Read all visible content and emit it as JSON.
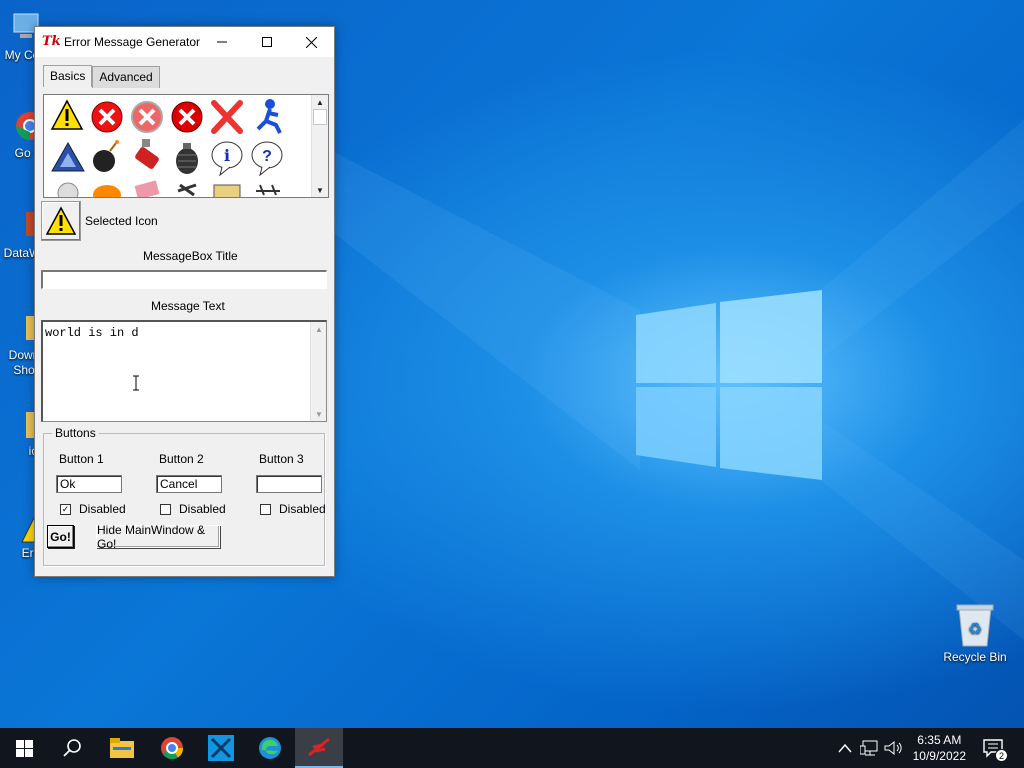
{
  "desktop": {
    "icons_left": [
      {
        "label": "My Co"
      },
      {
        "label": "Go Ch"
      },
      {
        "label": "DataW"
      },
      {
        "label": "Down Sho"
      },
      {
        "label": "ic"
      },
      {
        "label": "Erro"
      }
    ],
    "recycle_bin": "Recycle Bin"
  },
  "window": {
    "title": "Error Message Generator",
    "app_icon": "Tk",
    "tabs": [
      "Basics",
      "Advanced"
    ],
    "selected_icon_label": "Selected Icon",
    "messagebox_title_label": "MessageBox Title",
    "messagebox_title_value": "",
    "message_text_label": "Message Text",
    "message_text_value": "world is in d",
    "buttons_group": {
      "legend": "Buttons",
      "button1": {
        "label": "Button 1",
        "value": "Ok",
        "disabled_label": "Disabled",
        "disabled": true
      },
      "button2": {
        "label": "Button 2",
        "value": "Cancel",
        "disabled_label": "Disabled",
        "disabled": false
      },
      "button3": {
        "label": "Button 3",
        "value": "",
        "disabled_label": "Disabled",
        "disabled": false
      }
    },
    "go_button": "Go!",
    "hide_go_button": "Hide MainWindow & Go!"
  },
  "icon_grid": [
    "warning-icon",
    "error-red-icon",
    "error-gray-icon",
    "error-dark-icon",
    "x-icon",
    "aim-runner-icon",
    "delta-icon",
    "bomb-icon",
    "dynamite-icon",
    "grenade-icon",
    "info-bubble-icon",
    "question-bubble-icon",
    "misc-icon-1",
    "misc-icon-2",
    "misc-icon-3",
    "misc-icon-4",
    "folder-icon",
    "misc-icon-6"
  ],
  "taskbar": {
    "clock_time": "6:35 AM",
    "clock_date": "10/9/2022",
    "notification_count": "2"
  },
  "colors": {
    "taskbar": "#10151e",
    "desktop": "#0a76d6",
    "accent": "#76b9ed"
  }
}
